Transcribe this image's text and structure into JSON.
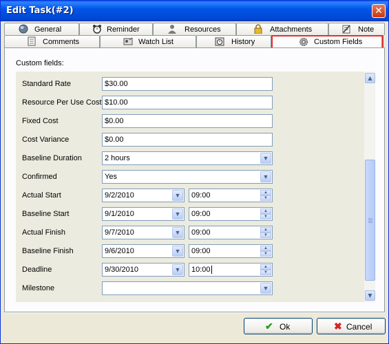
{
  "window": {
    "title": "Edit Task(#2)"
  },
  "tabs_row1": [
    {
      "label": "General",
      "icon": "globe-icon"
    },
    {
      "label": "Reminder",
      "icon": "alarm-clock-icon"
    },
    {
      "label": "Resources",
      "icon": "user-icon"
    },
    {
      "label": "Attachments",
      "icon": "lock-icon"
    },
    {
      "label": "Note",
      "icon": "note-icon"
    }
  ],
  "tabs_row2": [
    {
      "label": "Comments",
      "icon": "comments-icon"
    },
    {
      "label": "Watch List",
      "icon": "watch-list-icon"
    },
    {
      "label": "History",
      "icon": "history-icon"
    },
    {
      "label": "Custom Fields",
      "icon": "gear-icon",
      "active": true
    }
  ],
  "custom_fields_label": "Custom fields:",
  "fields": {
    "standard_rate": {
      "label": "Standard Rate",
      "value": "$30.00"
    },
    "resource_per_use_cost": {
      "label": "Resource Per Use Cost",
      "value": "$10.00"
    },
    "fixed_cost": {
      "label": "Fixed Cost",
      "value": "$0.00"
    },
    "cost_variance": {
      "label": "Cost Variance",
      "value": "$0.00"
    },
    "baseline_duration": {
      "label": "Baseline Duration",
      "value": "2 hours"
    },
    "confirmed": {
      "label": "Confirmed",
      "value": "Yes"
    },
    "actual_start": {
      "label": "Actual Start",
      "date": "9/2/2010",
      "time": "09:00"
    },
    "baseline_start": {
      "label": "Baseline Start",
      "date": "9/1/2010",
      "time": "09:00"
    },
    "actual_finish": {
      "label": "Actual Finish",
      "date": "9/7/2010",
      "time": "09:00"
    },
    "baseline_finish": {
      "label": "Baseline Finish",
      "date": "9/6/2010",
      "time": "09:00"
    },
    "deadline": {
      "label": "Deadline",
      "date": "9/30/2010",
      "time": "10:00"
    },
    "milestone": {
      "label": "Milestone",
      "value": ""
    }
  },
  "buttons": {
    "ok": "Ok",
    "cancel": "Cancel"
  },
  "colors": {
    "title_bar": "#0055e5",
    "highlight": "#e32f2a",
    "ok_check": "#2a9a1e",
    "cancel_x": "#d2231f"
  }
}
